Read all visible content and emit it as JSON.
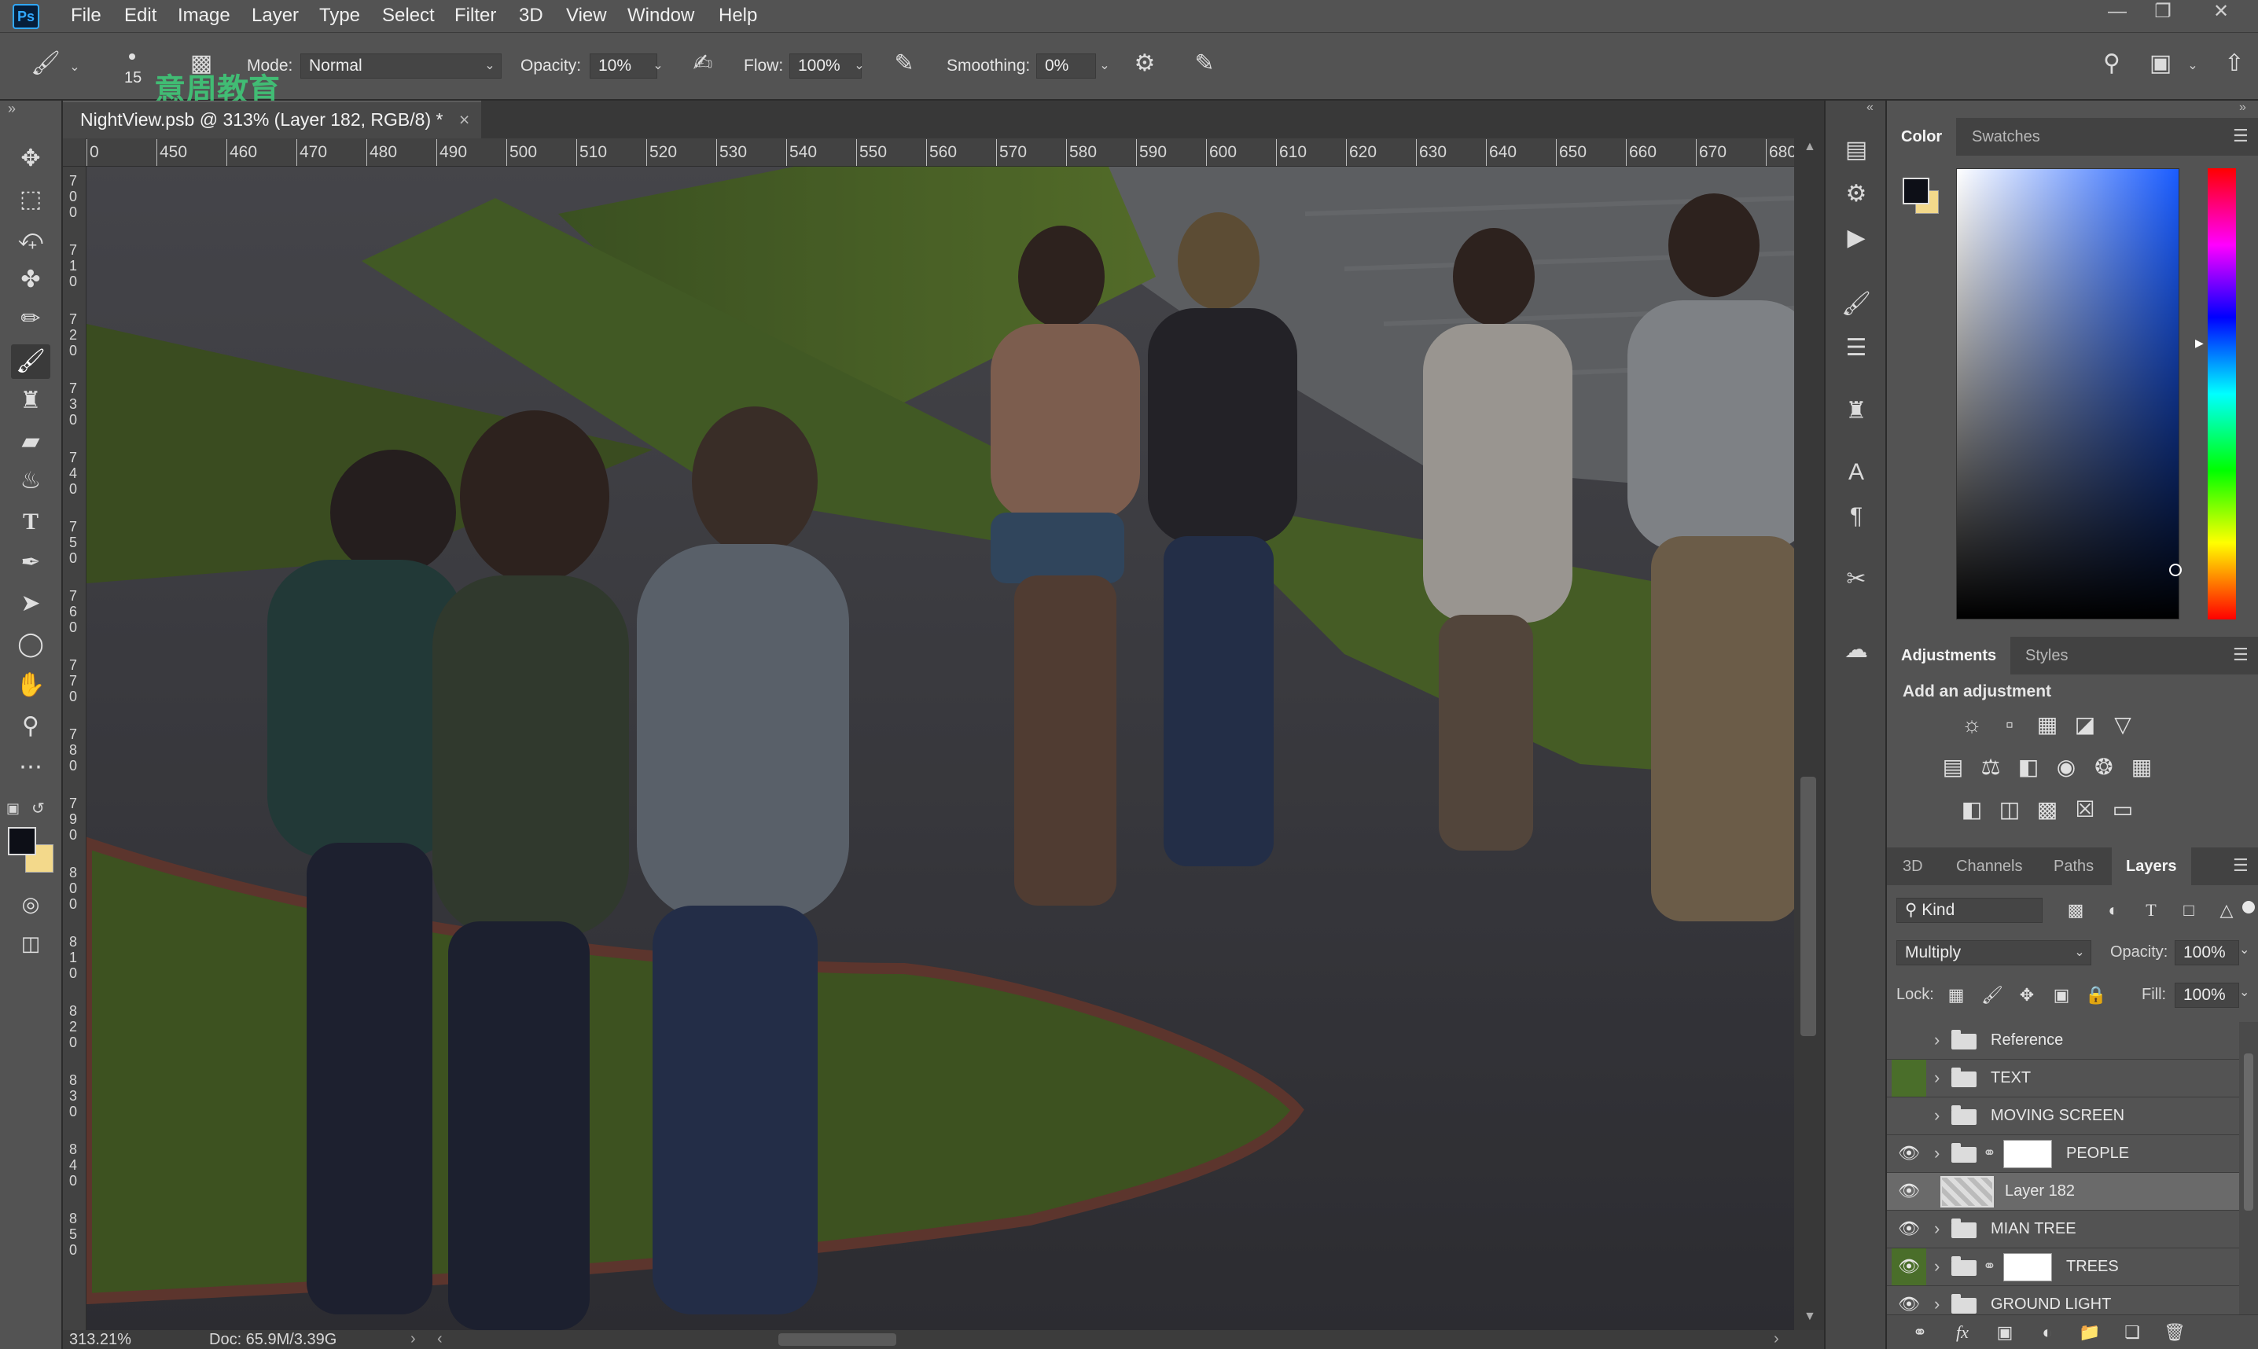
{
  "app": {
    "logo": "Ps"
  },
  "menu": [
    "File",
    "Edit",
    "Image",
    "Layer",
    "Type",
    "Select",
    "Filter",
    "3D",
    "View",
    "Window",
    "Help"
  ],
  "window_controls": [
    "minimize-icon",
    "restore-icon",
    "close-icon"
  ],
  "options": {
    "brush_size": "15",
    "mode_label": "Mode:",
    "mode_value": "Normal",
    "opacity_label": "Opacity:",
    "opacity_value": "10%",
    "flow_label": "Flow:",
    "flow_value": "100%",
    "smoothing_label": "Smoothing:",
    "smoothing_value": "0%",
    "watermark": "意周教育"
  },
  "document": {
    "tab_title": "NightView.psb @ 313% (Layer 182, RGB/8) *",
    "zoom": "313.21%",
    "doc_info": "Doc: 65.9M/3.39G"
  },
  "ruler_h": [
    "0",
    "450",
    "460",
    "470",
    "480",
    "490",
    "500",
    "510",
    "520",
    "530",
    "540",
    "550",
    "560",
    "570",
    "580",
    "590",
    "600",
    "610",
    "620",
    "630",
    "640",
    "650",
    "660",
    "670",
    "680"
  ],
  "ruler_v": [
    "7\n0\n0",
    "7\n1\n0",
    "7\n2\n0",
    "7\n3\n0",
    "7\n4\n0",
    "7\n5\n0",
    "7\n6\n0",
    "7\n7\n0",
    "7\n8\n0",
    "7\n9\n0",
    "8\n0\n0",
    "8\n1\n0",
    "8\n2\n0",
    "8\n3\n0",
    "8\n4\n0",
    "8\n5\n0"
  ],
  "color_panel": {
    "tabs": [
      "Color",
      "Swatches"
    ],
    "foreground": "#0d0f17",
    "background": "#f3d98b",
    "hue_color": "#1a5cff"
  },
  "adjustments_panel": {
    "tabs": [
      "Adjustments",
      "Styles"
    ],
    "heading": "Add an adjustment"
  },
  "layers_panel": {
    "tabs": [
      "3D",
      "Channels",
      "Paths",
      "Layers"
    ],
    "filter_kind": "Kind",
    "blend_mode": "Multiply",
    "opacity_label": "Opacity:",
    "opacity_value": "100%",
    "lock_label": "Lock:",
    "fill_label": "Fill:",
    "fill_value": "100%",
    "layers": [
      {
        "name": "Reference",
        "visible": false,
        "type": "group"
      },
      {
        "name": "TEXT",
        "visible": false,
        "type": "group",
        "tag": "green"
      },
      {
        "name": "MOVING SCREEN",
        "visible": false,
        "type": "group"
      },
      {
        "name": "PEOPLE",
        "visible": true,
        "type": "group-mask"
      },
      {
        "name": "Layer 182",
        "visible": true,
        "type": "layer",
        "selected": true
      },
      {
        "name": "MIAN TREE",
        "visible": true,
        "type": "group"
      },
      {
        "name": "TREES",
        "visible": true,
        "type": "group-mask",
        "tag": "green"
      },
      {
        "name": "GROUND LIGHT",
        "visible": true,
        "type": "group"
      }
    ]
  }
}
